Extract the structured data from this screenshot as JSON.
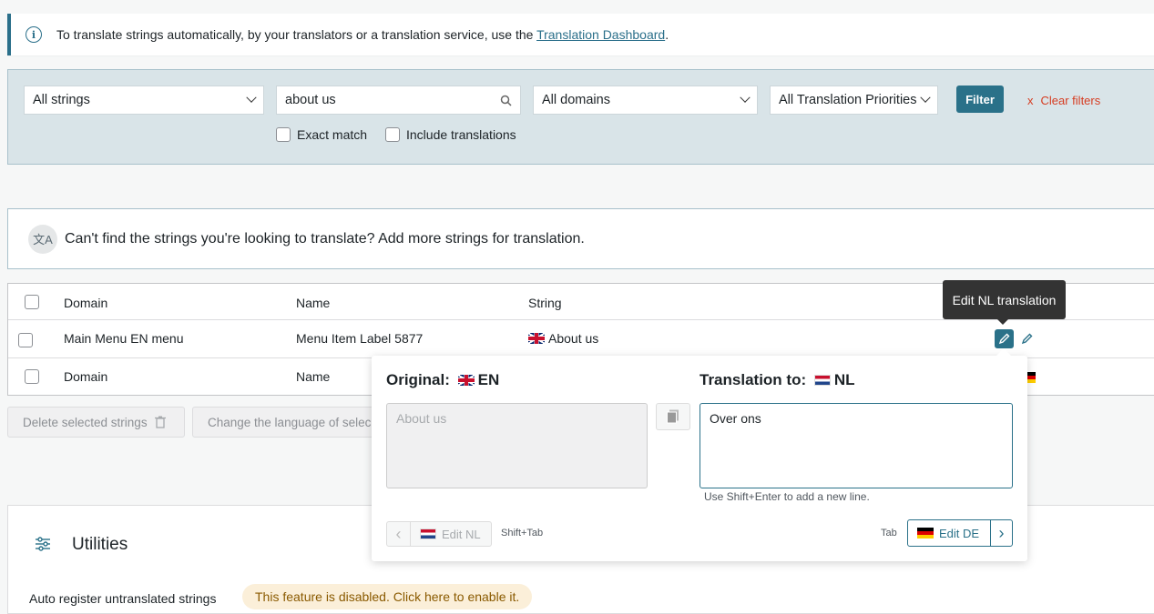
{
  "notice": {
    "text": "To translate strings automatically, by your translators or a translation service, use the ",
    "link": "Translation Dashboard",
    "period": "."
  },
  "filters": {
    "strings_select": "All strings",
    "search_value": "about us",
    "domains_select": "All domains",
    "priority_select": "All Translation Priorities",
    "filter_button": "Filter",
    "clear_filters": "Clear filters",
    "clear_icon": "x",
    "exact_match": "Exact match",
    "include_translations": "Include translations"
  },
  "add_strings": {
    "icon_text": "文A",
    "text": "Can't find the strings you're looking to translate? Add more strings for translation."
  },
  "table": {
    "headers": {
      "domain": "Domain",
      "name": "Name",
      "string": "String"
    },
    "rows": [
      {
        "domain": "Main Menu EN menu",
        "name": "Menu Item Label 5877",
        "string": "About us"
      }
    ],
    "footer": {
      "domain": "Domain",
      "name": "Name"
    }
  },
  "bulk": {
    "delete": "Delete selected strings",
    "change_language": "Change the language of selec"
  },
  "utilities": {
    "title": "Utilities",
    "auto_register": "Auto register untranslated strings",
    "disabled_badge": "This feature is disabled. Click here to enable it."
  },
  "tooltip": {
    "text": "Edit NL translation"
  },
  "popup": {
    "original_label": "Original:",
    "original_lang": "EN",
    "original_text": "About us",
    "translation_label": "Translation to:",
    "translation_lang": "NL",
    "translation_value": "Over ons",
    "hint": "Use Shift+Enter to add a new line.",
    "prev_label": "Edit NL",
    "prev_shortcut": "Shift+Tab",
    "next_shortcut": "Tab",
    "next_label": "Edit DE"
  },
  "colors": {
    "accent": "#2a7189",
    "clear": "#d63c21",
    "panel": "#d9e4e8"
  }
}
